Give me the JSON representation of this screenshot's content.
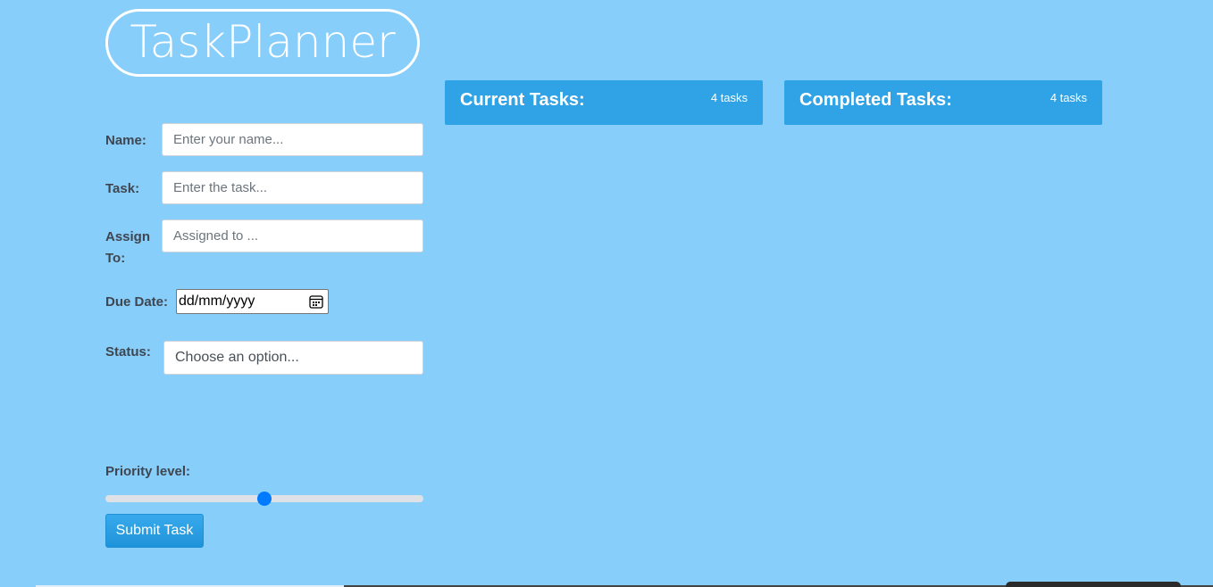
{
  "app": {
    "logo_text": "TaskPlanner"
  },
  "form": {
    "name": {
      "label": "Name:",
      "placeholder": "Enter your name..."
    },
    "task": {
      "label": "Task:",
      "placeholder": "Enter the task..."
    },
    "assign": {
      "label_line1": "Assign",
      "label_line2": "To:",
      "placeholder": "Assigned to ..."
    },
    "due_date": {
      "label": "Due Date:",
      "value": "dd/mm/yyyy"
    },
    "status": {
      "label": "Status:",
      "selected": "Choose an option..."
    },
    "priority": {
      "label": "Priority level:",
      "value": 50,
      "min": 0,
      "max": 100
    },
    "submit_label": "Submit Task"
  },
  "panels": {
    "current": {
      "title": "Current Tasks:",
      "count": "4 tasks"
    },
    "completed": {
      "title": "Completed Tasks:",
      "count": "4 tasks"
    }
  },
  "colors": {
    "background": "#87cefa",
    "panel": "#30a3e6",
    "accent": "#007bff"
  }
}
